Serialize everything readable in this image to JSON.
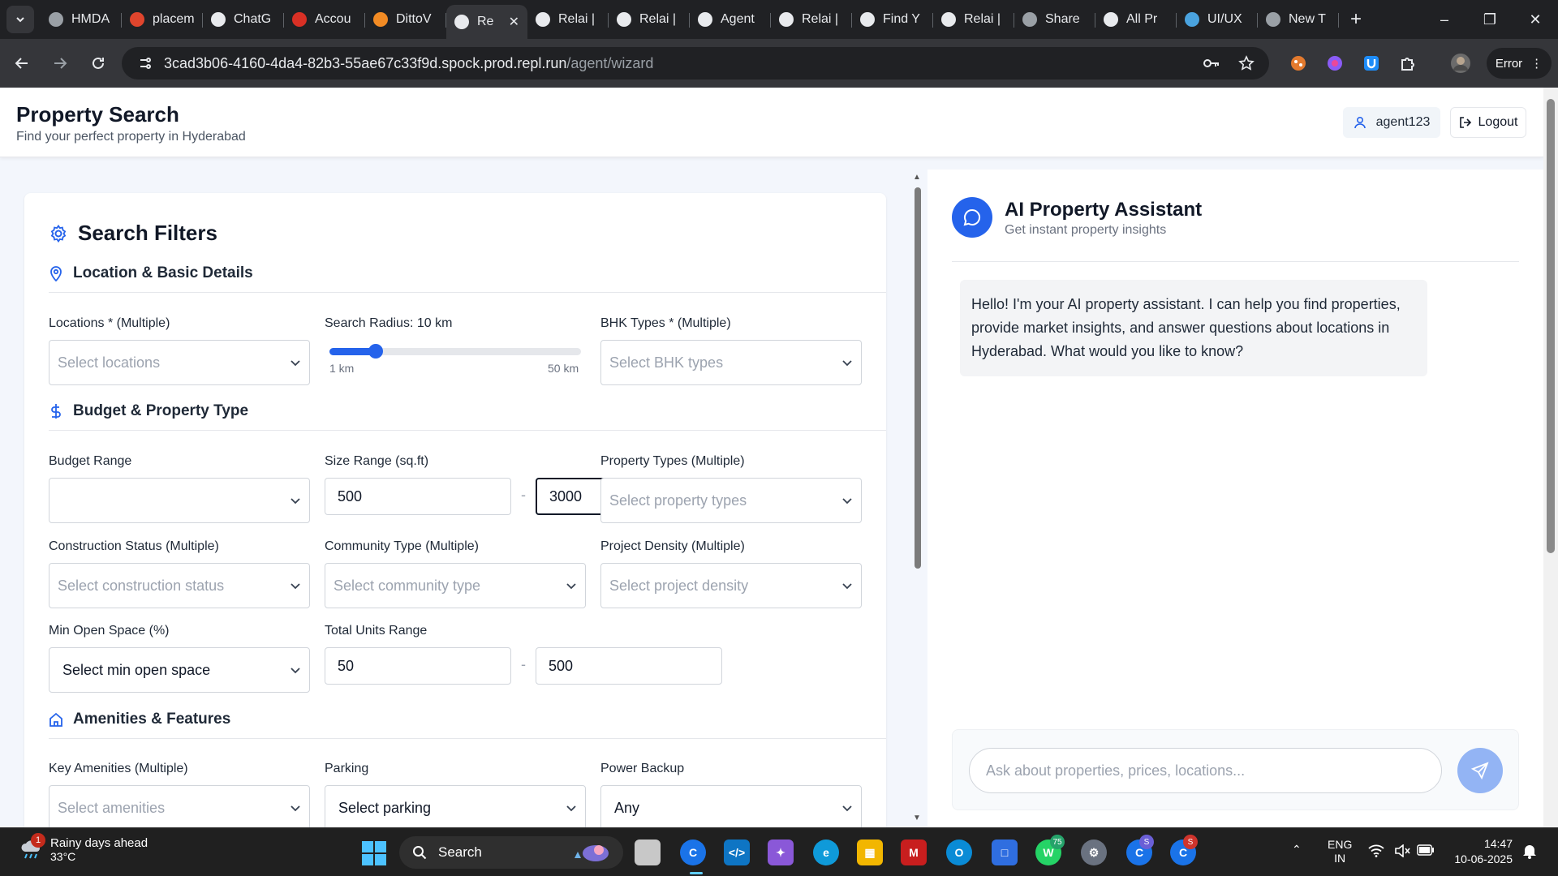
{
  "browser": {
    "tabs": [
      {
        "title": "HMDA",
        "favicon": "globe",
        "active": false
      },
      {
        "title": "placem",
        "favicon": "placement",
        "active": false
      },
      {
        "title": "ChatG",
        "favicon": "chatgpt",
        "active": false
      },
      {
        "title": "Accou",
        "favicon": "account",
        "active": false
      },
      {
        "title": "DittoV",
        "favicon": "ditto",
        "active": false
      },
      {
        "title": "Re",
        "favicon": "replit",
        "active": true
      },
      {
        "title": "Relai |",
        "favicon": "replit",
        "active": false
      },
      {
        "title": "Relai |",
        "favicon": "replit",
        "active": false
      },
      {
        "title": "Agent",
        "favicon": "replit",
        "active": false
      },
      {
        "title": "Relai |",
        "favicon": "replit",
        "active": false
      },
      {
        "title": "Find Y",
        "favicon": "replit",
        "active": false
      },
      {
        "title": "Relai |",
        "favicon": "replit",
        "active": false
      },
      {
        "title": "Share",
        "favicon": "globe",
        "active": false
      },
      {
        "title": "All Pr",
        "favicon": "replit",
        "active": false
      },
      {
        "title": "UI/UX",
        "favicon": "uiux",
        "active": false
      },
      {
        "title": "New T",
        "favicon": "globe",
        "active": false
      }
    ],
    "url_host": "3cad3b06-4160-4da4-82b3-55ae67c33f9d.spock.prod.repl.run",
    "url_path": "/agent/wizard",
    "error_label": "Error"
  },
  "header": {
    "title": "Property Search",
    "subtitle": "Find your perfect property in Hyderabad",
    "user": "agent123",
    "logout": "Logout"
  },
  "filters": {
    "title": "Search Filters",
    "sections": {
      "location": "Location & Basic Details",
      "budget": "Budget & Property Type",
      "amenities": "Amenities & Features"
    },
    "locations": {
      "label": "Locations * (Multiple)",
      "placeholder": "Select locations"
    },
    "radius": {
      "label": "Search Radius: 10 km",
      "min_label": "1 km",
      "max_label": "50 km",
      "value": 10,
      "min": 1,
      "max": 50
    },
    "bhk": {
      "label": "BHK Types * (Multiple)",
      "placeholder": "Select BHK types"
    },
    "budget": {
      "label": "Budget Range",
      "value": ""
    },
    "size": {
      "label": "Size Range (sq.ft)",
      "min": "500",
      "max": "3000"
    },
    "property_types": {
      "label": "Property Types (Multiple)",
      "placeholder": "Select property types"
    },
    "construction": {
      "label": "Construction Status (Multiple)",
      "placeholder": "Select construction status"
    },
    "community": {
      "label": "Community Type (Multiple)",
      "placeholder": "Select community type"
    },
    "density": {
      "label": "Project Density (Multiple)",
      "placeholder": "Select project density"
    },
    "open_space": {
      "label": "Min Open Space (%)",
      "value": "Select min open space"
    },
    "units": {
      "label": "Total Units Range",
      "min": "50",
      "max": "500"
    },
    "amenities": {
      "label": "Key Amenities (Multiple)",
      "placeholder": "Select amenities"
    },
    "parking": {
      "label": "Parking",
      "value": "Select parking"
    },
    "power": {
      "label": "Power Backup",
      "value": "Any"
    },
    "separator": "-"
  },
  "assistant": {
    "title": "AI Property Assistant",
    "subtitle": "Get instant property insights",
    "message": "Hello! I'm your AI property assistant. I can help you find properties, provide market insights, and answer questions about locations in Hyderabad. What would you like to know?",
    "input_placeholder": "Ask about properties, prices, locations..."
  },
  "taskbar": {
    "weather_title": "Rainy days ahead",
    "weather_temp": "33°C",
    "weather_badge": "1",
    "search_label": "Search",
    "whatsapp_badge": "75",
    "lang_line1": "ENG",
    "lang_line2": "IN",
    "time": "14:47",
    "date": "10-06-2025"
  },
  "colors": {
    "accent": "#2563eb",
    "send_disabled": "#93b4f4"
  }
}
